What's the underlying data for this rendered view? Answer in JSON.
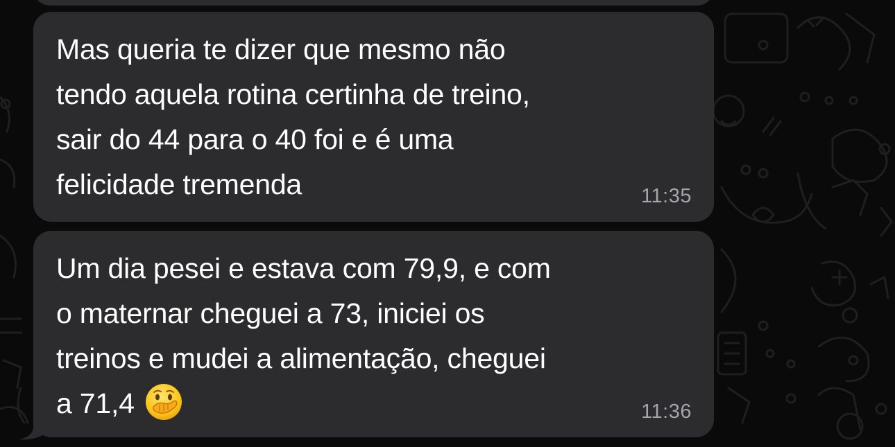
{
  "messages": [
    {
      "text": "Mas queria te dizer que mesmo não\ntendo aquela rotina certinha de treino,\nsair do 44 para o 40 foi e é uma\nfelicidade tremenda",
      "time": "11:35"
    },
    {
      "text": "Um dia pesei e estava com 79,9, e com\no maternar cheguei a 73, iniciei os\ntreinos e mudei a alimentação, cheguei\na 71,4",
      "emoji": "face-with-hand-over-mouth-icon",
      "time": "11:36"
    }
  ],
  "colors": {
    "background": "#0a0a0a",
    "bubble": "#2c2c2e",
    "text": "#ffffff",
    "timestamp": "#a5a5aa",
    "wallpaper_doodle": "#1e1e1e"
  }
}
